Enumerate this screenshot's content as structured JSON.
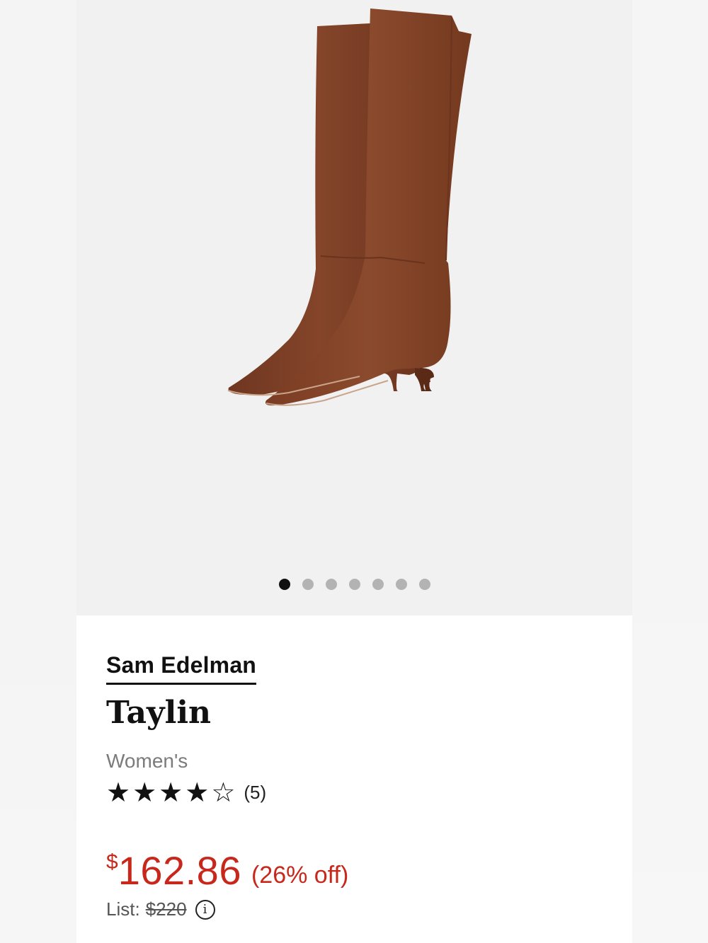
{
  "product": {
    "brand": "Sam Edelman",
    "name": "Taylin",
    "gender": "Women's",
    "rating": 4,
    "rating_max": 5,
    "review_count": "(5)",
    "price_symbol": "$",
    "price_value": "162.86",
    "discount": "(26% off)",
    "list_label": "List:",
    "list_price": "$220"
  },
  "carousel": {
    "total": 7,
    "active_index": 0
  },
  "colors": {
    "price": "#c8281b",
    "boot": "#7c3f24"
  },
  "icons": {
    "info": "info-icon",
    "star_filled": "star-filled-icon",
    "star_empty": "star-empty-icon"
  }
}
